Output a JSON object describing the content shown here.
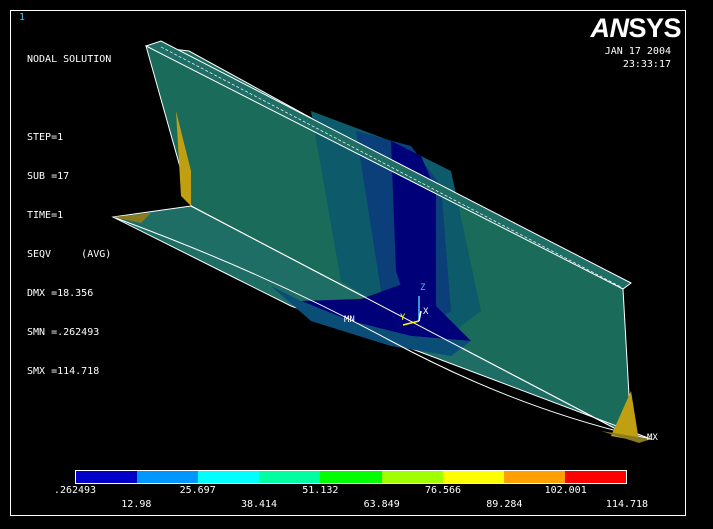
{
  "window_number": "1",
  "logo": {
    "an": "AN",
    "sys": "SYS"
  },
  "date": "JAN 17 2004",
  "time": "23:33:17",
  "info": {
    "title": "NODAL SOLUTION",
    "step": "STEP=1",
    "sub": "SUB =17",
    "time": "TIME=1",
    "seqv": "SEQV     (AVG)",
    "dmx": "DMX =18.356",
    "smn": "SMN =.262493",
    "smx": "SMX =114.718"
  },
  "markers": {
    "min": "MN",
    "max": "MX"
  },
  "triad": {
    "z": "Z",
    "y": "Y",
    "x": "X"
  },
  "legend": {
    "colors": [
      "#0000c8",
      "#0096ff",
      "#00ffff",
      "#00ffa0",
      "#00ff00",
      "#a0ff00",
      "#ffff00",
      "#ffa000",
      "#ff0000"
    ],
    "top_ticks": [
      ".262493",
      "25.697",
      "51.132",
      "76.566",
      "102.001"
    ],
    "bottom_ticks": [
      "12.98",
      "38.414",
      "63.849",
      "89.284",
      "114.718"
    ]
  },
  "colors": {
    "web": "#1a6b5a",
    "flange": "#1f6e66",
    "stress_low": "#000080",
    "stress_mid": "#0a4e78",
    "edge": "#c0a010"
  }
}
